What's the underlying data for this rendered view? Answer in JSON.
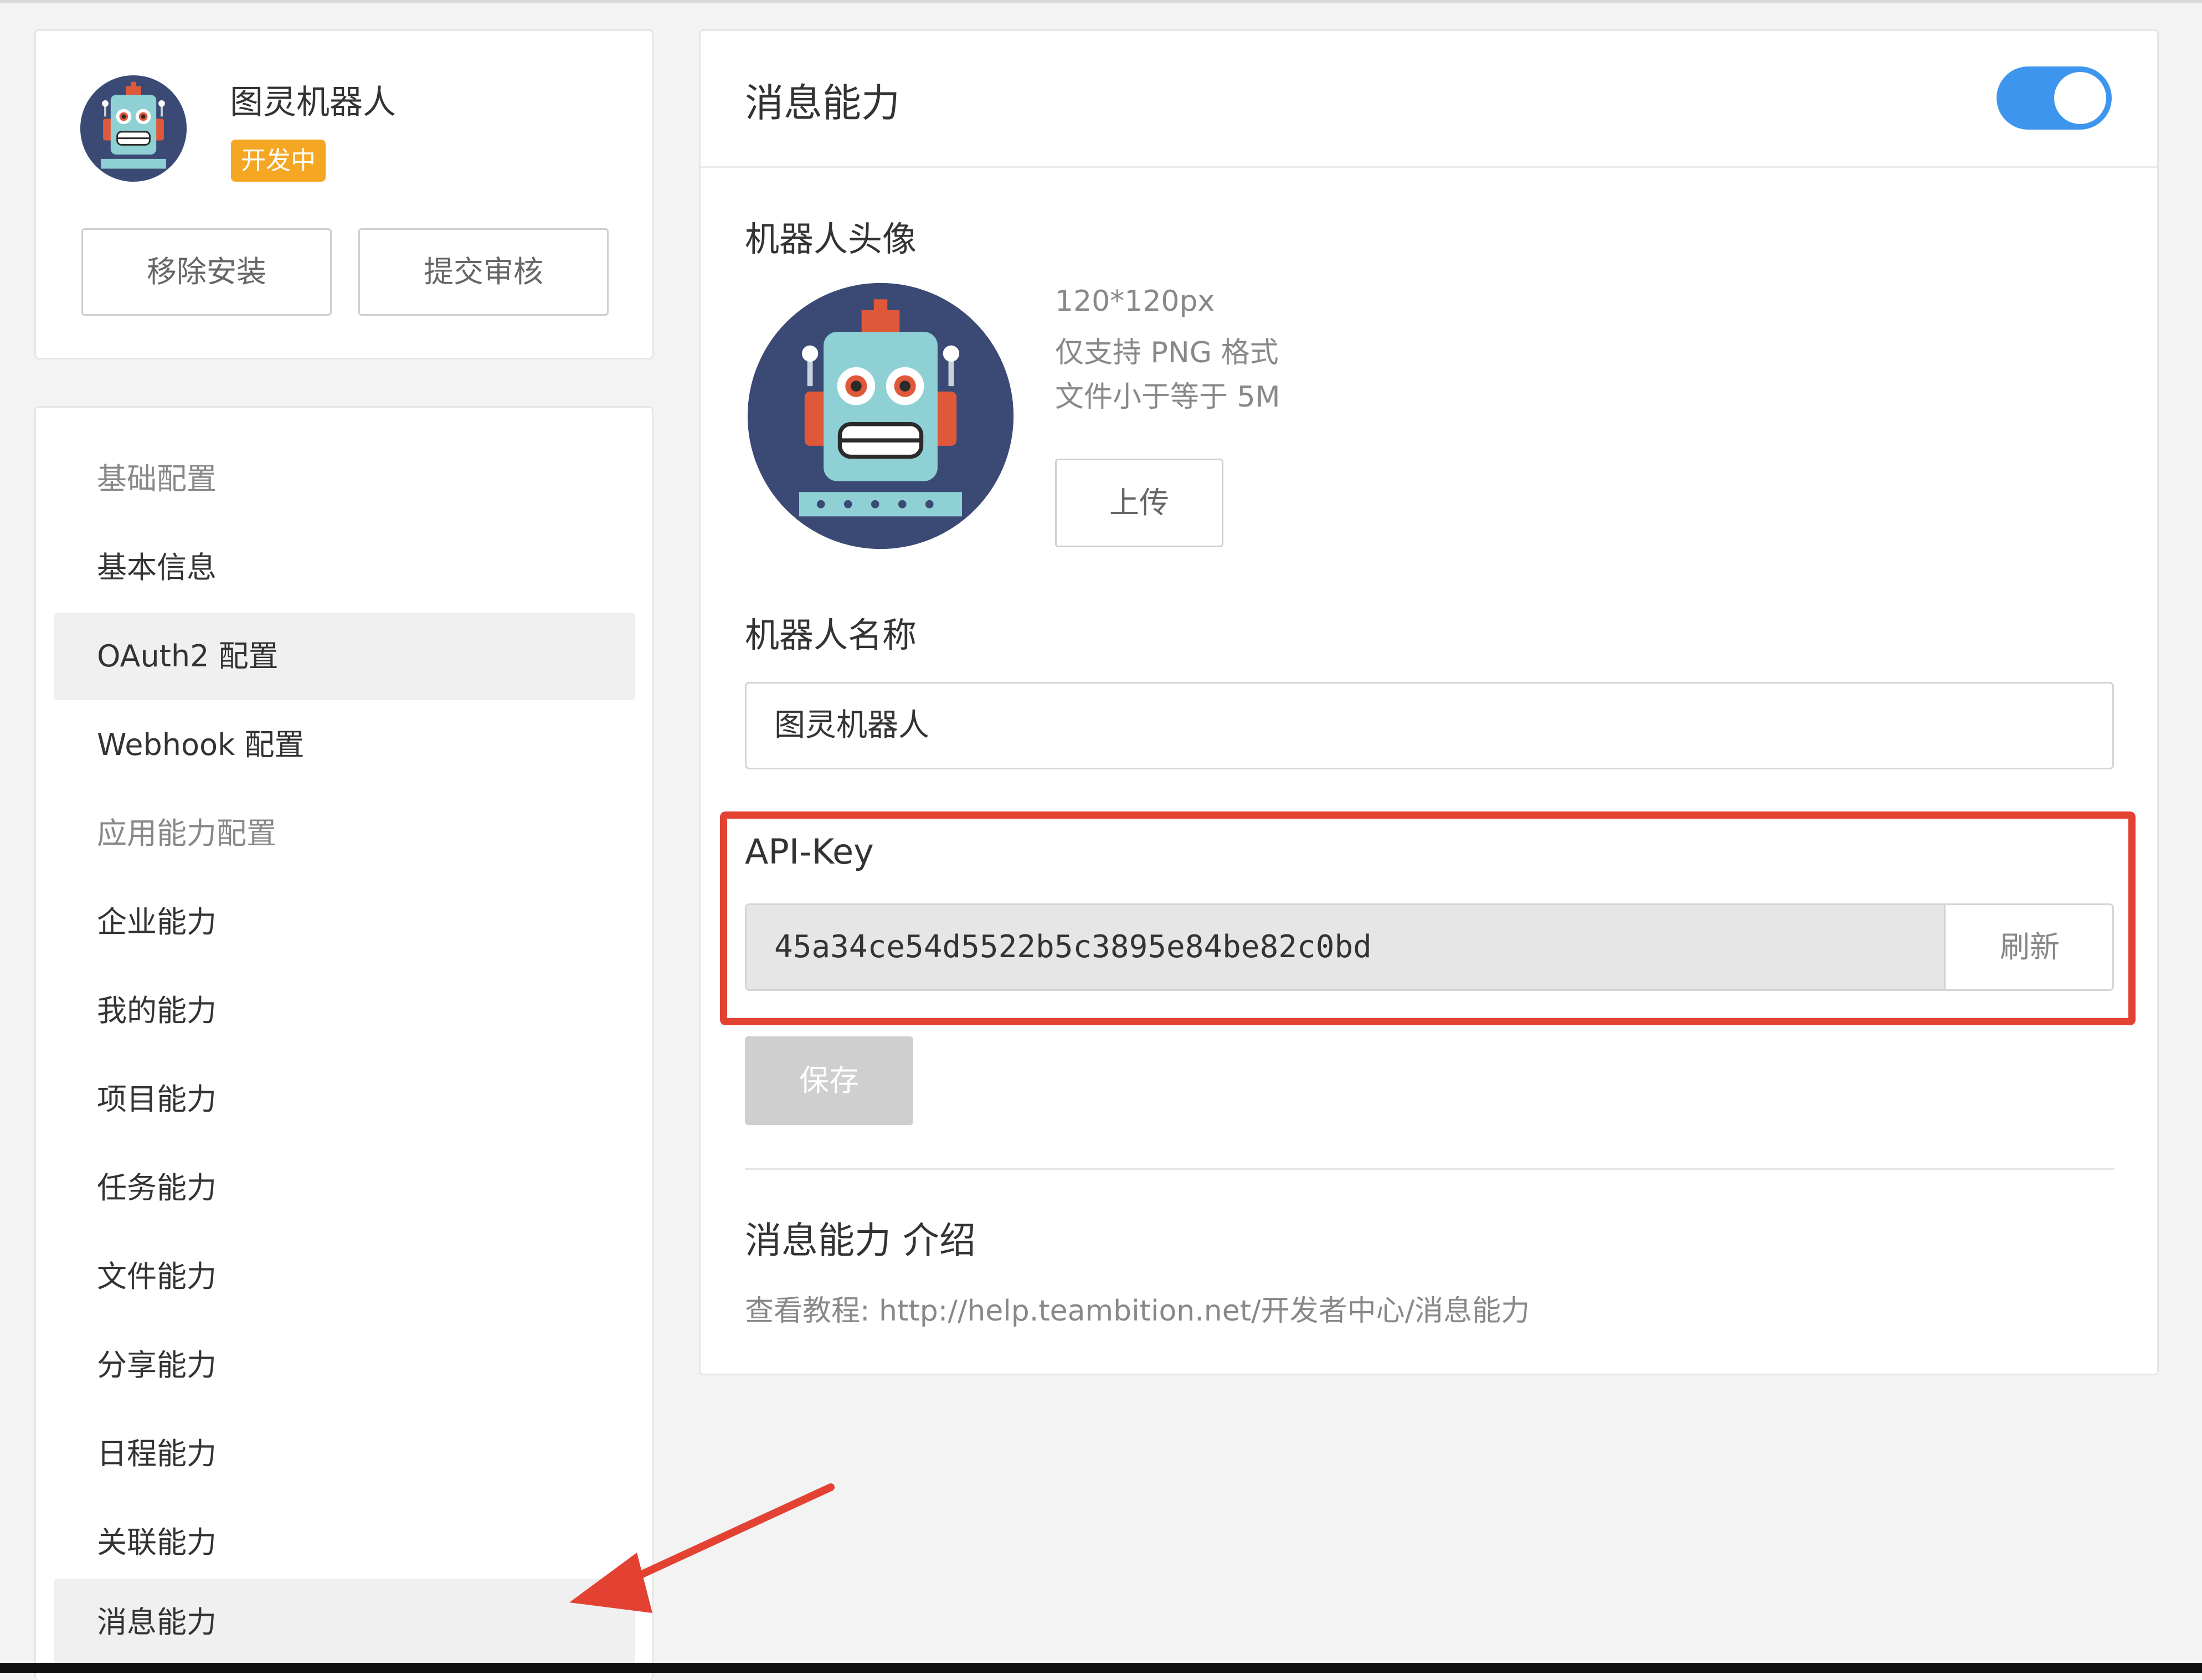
{
  "app": {
    "name": "图灵机器人",
    "status_badge": "开发中",
    "remove_label": "移除安装",
    "submit_label": "提交审核"
  },
  "sidebar": {
    "items": [
      {
        "label": "基础配置",
        "kind": "group"
      },
      {
        "label": "基本信息",
        "kind": "link"
      },
      {
        "label": "OAuth2 配置",
        "kind": "link",
        "active": true
      },
      {
        "label": "Webhook 配置",
        "kind": "link"
      },
      {
        "label": "应用能力配置",
        "kind": "group"
      },
      {
        "label": "企业能力",
        "kind": "link"
      },
      {
        "label": "我的能力",
        "kind": "link"
      },
      {
        "label": "项目能力",
        "kind": "link"
      },
      {
        "label": "任务能力",
        "kind": "link"
      },
      {
        "label": "文件能力",
        "kind": "link"
      },
      {
        "label": "分享能力",
        "kind": "link"
      },
      {
        "label": "日程能力",
        "kind": "link"
      },
      {
        "label": "关联能力",
        "kind": "link"
      },
      {
        "label": "消息能力",
        "kind": "link",
        "active": true
      }
    ]
  },
  "main": {
    "title": "消息能力",
    "toggle_on": true,
    "avatar_section": {
      "label": "机器人头像",
      "hints": [
        "120*120px",
        "仅支持 PNG 格式",
        "文件小于等于 5M"
      ],
      "upload_label": "上传"
    },
    "name_section": {
      "label": "机器人名称",
      "value": "图灵机器人"
    },
    "api_key_section": {
      "label": "API-Key",
      "value": "45a34ce54d5522b5c3895e84be82c0bd",
      "refresh_label": "刷新"
    },
    "save_label": "保存",
    "intro": {
      "title": "消息能力 介绍",
      "link_text": "查看教程: http://help.teambition.net/开发者中心/消息能力"
    }
  },
  "colors": {
    "toggle_on": "#3d95ee",
    "badge": "#f5a623",
    "highlight": "#e34233",
    "robot_bg": "#3b4a75",
    "robot_body": "#8ed0d3",
    "robot_accent": "#e0583a"
  }
}
